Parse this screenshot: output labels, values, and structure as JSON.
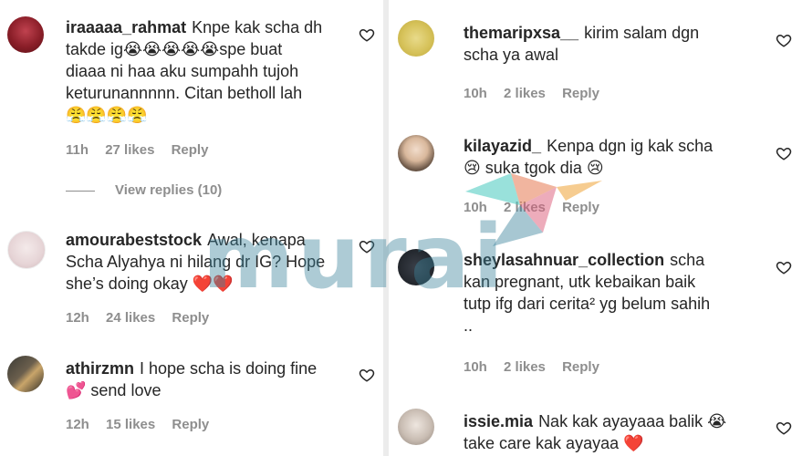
{
  "colors": {
    "text": "#262626",
    "meta": "#8e8e8e",
    "heart_red": "#e0243d",
    "watermark": "#3c829b"
  },
  "watermark": {
    "text": "murai"
  },
  "left_comments": [
    {
      "username": "iraaaaa_rahmat",
      "lines": [
        "Knpe kak scha dh",
        "takde ig😭😭😭😭😭spe buat",
        "diaaa ni haa aku sumpahh tujoh",
        "keturunannnnn. Citan betholl lah",
        "😤😤😤😤"
      ],
      "time": "11h",
      "likes": "27 likes",
      "reply": "Reply",
      "view_replies": "View replies (10)"
    },
    {
      "username": "amourabeststock",
      "lines": [
        "Awal, kenapa",
        "Scha Alyahya ni hilang dr IG? Hope",
        "she’s doing okay ❤️❤️"
      ],
      "time": "12h",
      "likes": "24 likes",
      "reply": "Reply"
    },
    {
      "username": "athirzmn",
      "lines": [
        "I hope scha is doing fine",
        "💕 send love"
      ],
      "time": "12h",
      "likes": "15 likes",
      "reply": "Reply"
    }
  ],
  "right_comments": [
    {
      "username": "themaripxsa__",
      "lines": [
        "kirim salam dgn",
        "scha ya awal"
      ],
      "time": "10h",
      "likes": "2 likes",
      "reply": "Reply"
    },
    {
      "username": "kilayazid_",
      "lines": [
        "Kenpa dgn ig kak scha",
        "😢 suka tgok dia 😢"
      ],
      "time": "10h",
      "likes": "2 likes",
      "reply": "Reply"
    },
    {
      "username": "sheylasahnuar_collection",
      "lines": [
        "scha",
        "kan pregnant, utk kebaikan baik",
        "tutp ifg dari cerita² yg belum sahih",
        ".."
      ],
      "time": "10h",
      "likes": "2 likes",
      "reply": "Reply"
    },
    {
      "username": "issie.mia",
      "lines": [
        "Nak kak ayayaaa balik 😭",
        "take care kak ayayaa ❤️"
      ],
      "time": "",
      "likes": "",
      "reply": ""
    }
  ]
}
